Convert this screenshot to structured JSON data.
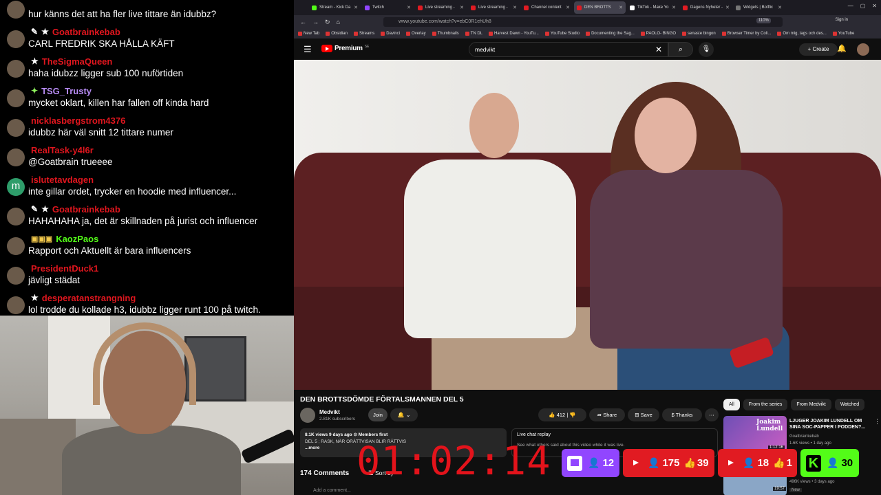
{
  "chat": {
    "messages": [
      {
        "user": "",
        "badges": [],
        "color": "#ffffff",
        "text": "hur känns det att ha fler live tittare än idubbz?",
        "avatar": "user"
      },
      {
        "user": "Goatbrainkebab",
        "badges": [
          "✎",
          "★"
        ],
        "color": "#e0161e",
        "text": "CARL FREDRIK SKA HÅLLA KÄFT",
        "avatar": "user"
      },
      {
        "user": "TheSigmaQueen",
        "badges": [
          "★"
        ],
        "color": "#e0161e",
        "text": "haha idubzz ligger sub 100 nuförtiden",
        "avatar": "user"
      },
      {
        "user": "TSG_Trusty",
        "badges": [
          "✦"
        ],
        "color": "#b88cf5",
        "text": "mycket oklart, killen har fallen off kinda hard",
        "avatar": "user"
      },
      {
        "user": "nicklasbergstrom4376",
        "badges": [],
        "color": "#e0161e",
        "text": "idubbz här väl snitt 12 tittare numer",
        "avatar": "user"
      },
      {
        "user": "RealTask-y4l6r",
        "badges": [],
        "color": "#e0161e",
        "text": "@Goatbrain trueeee",
        "avatar": "user"
      },
      {
        "user": "islutetavdagen",
        "badges": [],
        "color": "#e0161e",
        "text": "inte gillar ordet, trycker en hoodie med influencer...",
        "avatar": "m"
      },
      {
        "user": "Goatbrainkebab",
        "badges": [
          "✎",
          "★"
        ],
        "color": "#e0161e",
        "text": "HAHAHAHA ja, det är skillnaden på jurist och influencer",
        "avatar": "user"
      },
      {
        "user": "KaozPaos",
        "badges": [
          "▣▣▣"
        ],
        "color": "#53fc18",
        "text": "Rapport och Aktuellt är bara influencers",
        "avatar": "user"
      },
      {
        "user": "PresidentDuck1",
        "badges": [],
        "color": "#e0161e",
        "text": "jävligt städat",
        "avatar": "user"
      },
      {
        "user": "desperatanstrangning",
        "badges": [
          "★"
        ],
        "color": "#e0161e",
        "text": "lol trodde du kollade h3, idubbz ligger runt 100 på twitch.",
        "avatar": "user"
      }
    ]
  },
  "browser": {
    "tabs": [
      {
        "label": "Stream - Kick Da",
        "color": "#53fc18",
        "active": false
      },
      {
        "label": "Twitch",
        "color": "#9146ff",
        "active": false
      },
      {
        "label": "Live streaming - ",
        "color": "#e11b22",
        "active": false
      },
      {
        "label": "Live streaming - ",
        "color": "#e11b22",
        "active": false
      },
      {
        "label": "Channel content",
        "color": "#e11b22",
        "active": false
      },
      {
        "label": "DEN BROTTS",
        "color": "#e11b22",
        "active": true
      },
      {
        "label": "TikTok - Make Yo",
        "color": "#ffffff",
        "active": false
      },
      {
        "label": "Dagens Nyheter - ",
        "color": "#e11b22",
        "active": false
      },
      {
        "label": "Widgets | Botflix",
        "color": "#777777",
        "active": false
      }
    ],
    "url": "www.youtube.com/watch?v=ebC0R1ehUh8",
    "zoom": "110%",
    "signin": "Sign in",
    "bookmarks": [
      "New Tab",
      "Obsidian",
      "Streams",
      "Davinci",
      "Overlay",
      "Thumbnails",
      "TN DL",
      "Harvest Dawn - YouTu...",
      "YouTube Studio",
      "Documenting the Sag...",
      "PAOLO- BINGO",
      "senaste bingon",
      "Browser Timer by Coli...",
      "Om mig, tags och des...",
      "YouTube"
    ]
  },
  "youtube": {
    "brand": "Premium",
    "brand_sup": "SE",
    "search_value": "medvikt",
    "create_label": "Create",
    "video_title": "DEN BROTTSDÖMDE FÖRTALSMANNEN DEL 5",
    "channel_name": "Medvikt",
    "subscribers": "2.81K subscribers",
    "join_label": "Join",
    "like_count": "412",
    "share_label": "Share",
    "save_label": "Save",
    "thanks_label": "Thanks",
    "desc_meta": "8.1K views  9 days ago  ⊙ Members first",
    "desc_body": "DEL 5 ; RASK, NÄR ORÄTTVISAN BLIR RÄTTVIS",
    "desc_more": "...more",
    "live_replay_title": "Live chat replay",
    "live_replay_sub": "See what others said about this video while it was live.",
    "comments_count": "174 Comments",
    "sort_label": "Sort by",
    "add_comment": "Add a comment...",
    "chips": [
      "All",
      "From the series",
      "From Medvikt",
      "Watched"
    ],
    "related": [
      {
        "thumb_text": "Joakim Lundell",
        "duration": "1:12:16",
        "title": "LJUGER JOAKIM LUNDELL OM SINA SOC-PAPPER I PODDEN?...",
        "channel": "Goatbrainkebab",
        "meta": "1.6K views  •  1 day ago"
      },
      {
        "duration": "19:57",
        "meta": "496K views  •  3 days ago",
        "badge": "New"
      }
    ]
  },
  "overlay": {
    "timer": "01:02:14",
    "stats": {
      "twitch_viewers": "12",
      "yt1_viewers": "175",
      "yt1_likes": "39",
      "yt2_viewers": "18",
      "yt2_likes": "1",
      "kick_viewers": "30"
    },
    "colors": {
      "twitch": "#9146ff",
      "youtube": "#e11b22",
      "kick": "#53fc18",
      "timer": "#e3131b"
    }
  }
}
